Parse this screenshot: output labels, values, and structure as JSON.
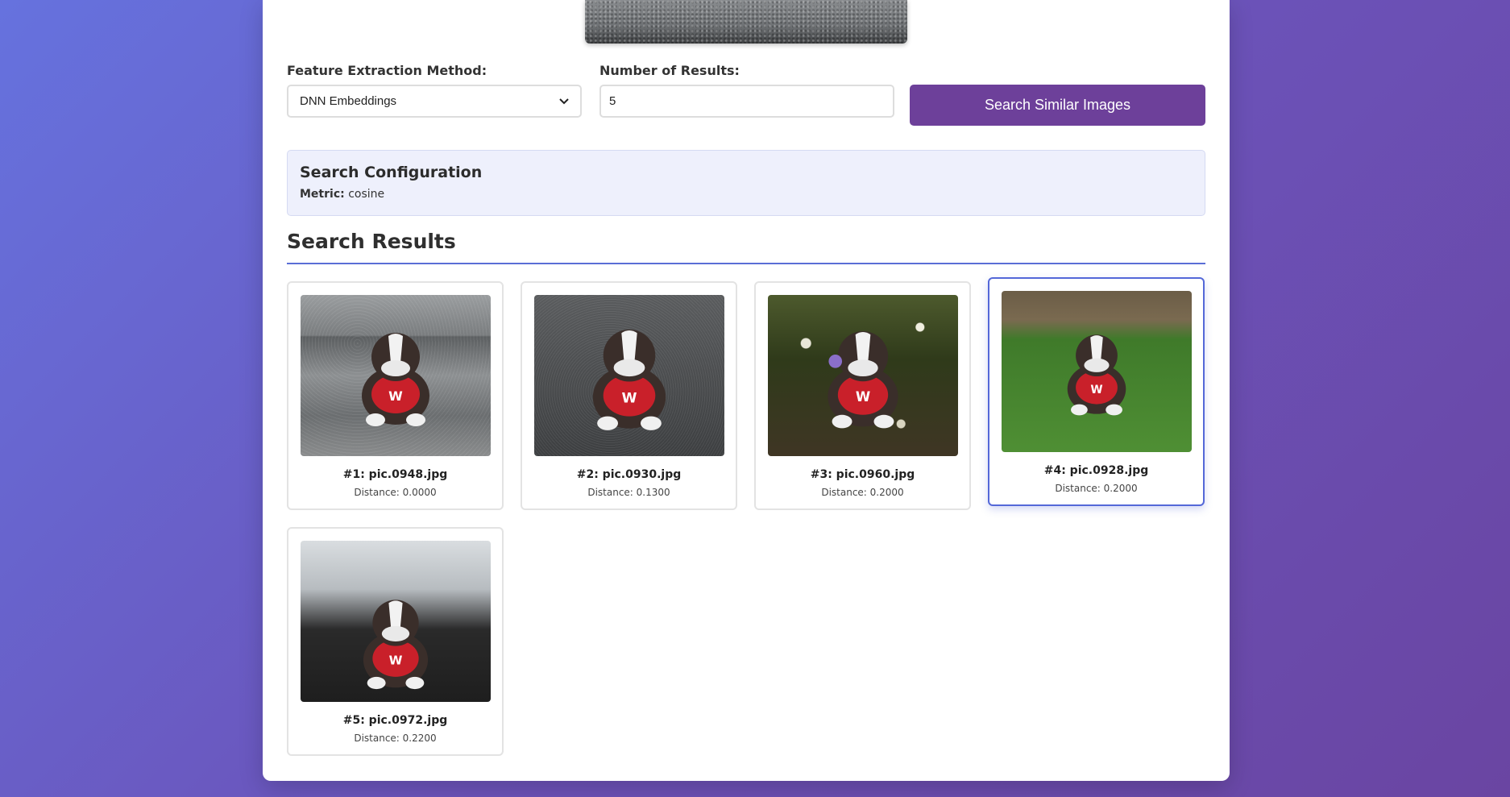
{
  "controls": {
    "method_label": "Feature Extraction Method:",
    "method_value": "DNN Embeddings",
    "results_label": "Number of Results:",
    "results_value": "5",
    "search_button": "Search Similar Images"
  },
  "config": {
    "title": "Search Configuration",
    "metric_label": "Metric:",
    "metric_value": "cosine"
  },
  "results": {
    "title": "Search Results",
    "items": [
      {
        "name": "#1: pic.0948.jpg",
        "distance": "Distance: 0.0000"
      },
      {
        "name": "#2: pic.0930.jpg",
        "distance": "Distance: 0.1300"
      },
      {
        "name": "#3: pic.0960.jpg",
        "distance": "Distance: 0.2000"
      },
      {
        "name": "#4: pic.0928.jpg",
        "distance": "Distance: 0.2000"
      },
      {
        "name": "#5: pic.0972.jpg",
        "distance": "Distance: 0.2200"
      }
    ]
  },
  "colors": {
    "accent": "#6d409a",
    "highlight_border": "#5468d8",
    "config_bg": "#eef0fc"
  }
}
